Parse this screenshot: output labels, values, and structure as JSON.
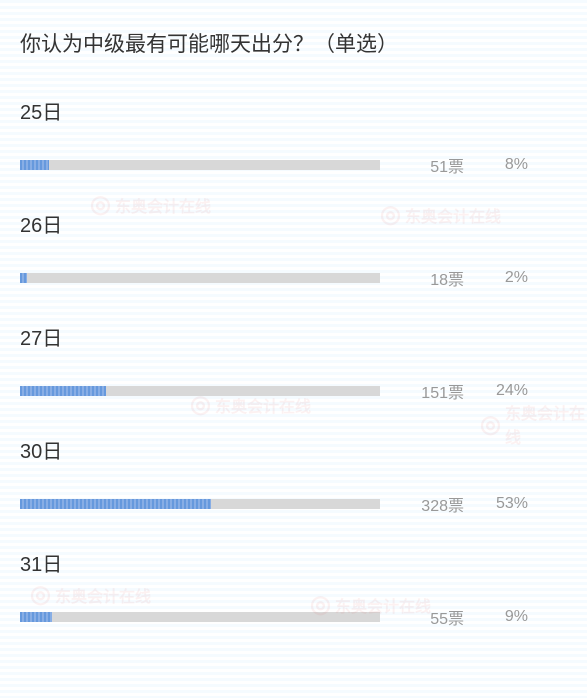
{
  "title": "你认为中级最有可能哪天出分？（单选）",
  "watermark_text": "东奥会计在线",
  "ylim": [
    0,
    100
  ],
  "chart_data": {
    "type": "bar",
    "title": "你认为中级最有可能哪天出分？（单选）",
    "categories": [
      "25日",
      "26日",
      "27日",
      "30日",
      "31日"
    ],
    "series": [
      {
        "name": "票",
        "values": [
          51,
          18,
          151,
          328,
          55
        ]
      },
      {
        "name": "%",
        "values": [
          8,
          2,
          24,
          53,
          9
        ]
      }
    ],
    "xlabel": "",
    "ylabel": ""
  },
  "items": [
    {
      "label": "25日",
      "votes": "51票",
      "percent": "8%",
      "width": 8
    },
    {
      "label": "26日",
      "votes": "18票",
      "percent": "2%",
      "width": 2
    },
    {
      "label": "27日",
      "votes": "151票",
      "percent": "24%",
      "width": 24
    },
    {
      "label": "30日",
      "votes": "328票",
      "percent": "53%",
      "width": 53
    },
    {
      "label": "31日",
      "votes": "55票",
      "percent": "9%",
      "width": 9
    }
  ]
}
